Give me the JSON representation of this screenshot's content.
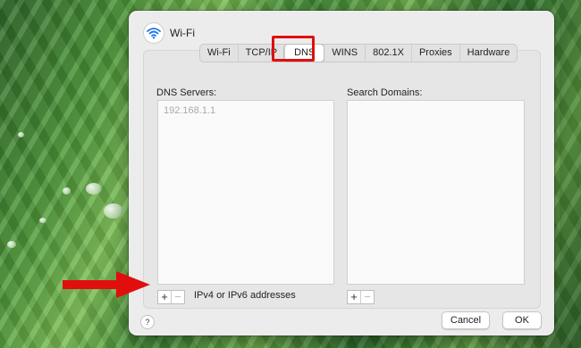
{
  "window": {
    "title": "Wi-Fi",
    "icon": "wifi-icon"
  },
  "tabs": [
    "Wi-Fi",
    "TCP/IP",
    "DNS",
    "WINS",
    "802.1X",
    "Proxies",
    "Hardware"
  ],
  "active_tab": "DNS",
  "dns_servers": {
    "label": "DNS Servers:",
    "entries": [
      "192.168.1.1"
    ],
    "add": "+",
    "remove": "−",
    "hint": "IPv4 or IPv6 addresses"
  },
  "search_domains": {
    "label": "Search Domains:",
    "add": "+",
    "remove": "−"
  },
  "footer": {
    "help": "?",
    "cancel": "Cancel",
    "ok": "OK"
  },
  "colors": {
    "highlight": "#e10e0e",
    "arrow": "#e10e0e",
    "wifi": "#1a73e8"
  }
}
